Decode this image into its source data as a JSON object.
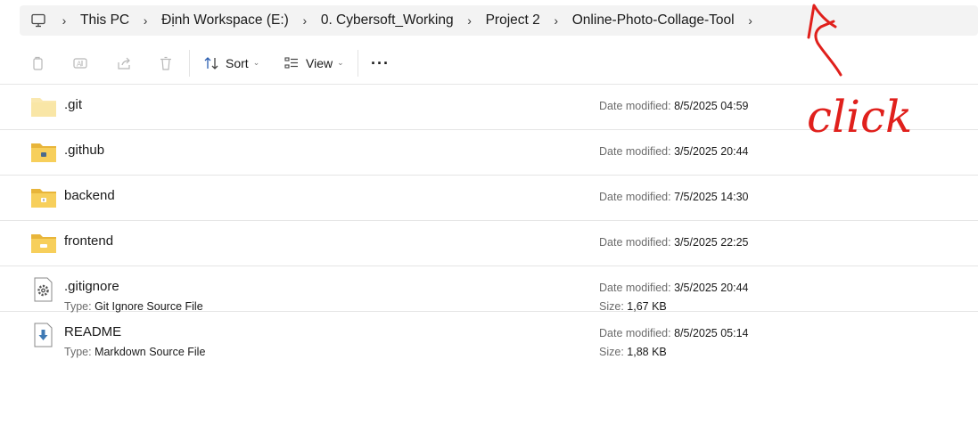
{
  "breadcrumb": {
    "items": [
      "This PC",
      "Định Workspace (E:)",
      "0. Cybersoft_Working",
      "Project 2",
      "Online-Photo-Collage-Tool"
    ]
  },
  "toolbar": {
    "sort_label": "Sort",
    "view_label": "View",
    "more_label": "···"
  },
  "labels": {
    "date_modified": "Date modified:",
    "type": "Type:",
    "size": "Size:"
  },
  "files": [
    {
      "name": ".git",
      "icon": "folder-icon",
      "date": "8/5/2025 04:59"
    },
    {
      "name": ".github",
      "icon": "folder-icon",
      "date": "3/5/2025 20:44"
    },
    {
      "name": "backend",
      "icon": "folder-icon",
      "date": "7/5/2025 14:30"
    },
    {
      "name": "frontend",
      "icon": "folder-icon",
      "date": "3/5/2025 22:25"
    },
    {
      "name": ".gitignore",
      "icon": "gear-file-icon",
      "type": "Git Ignore Source File",
      "date": "3/5/2025 20:44",
      "size": "1,67 KB"
    },
    {
      "name": "README",
      "icon": "markdown-file-icon",
      "type": "Markdown Source File",
      "date": "8/5/2025 05:14",
      "size": "1,88 KB"
    }
  ],
  "annotation": {
    "text": "click",
    "color": "#e0201c"
  }
}
